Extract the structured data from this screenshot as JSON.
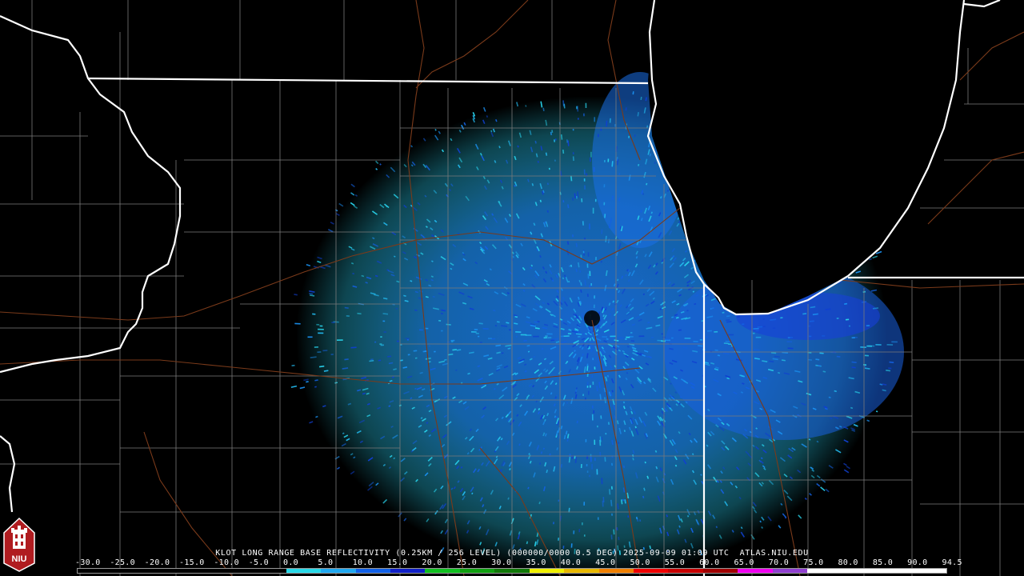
{
  "caption": "KLOT LONG RANGE BASE REFLECTIVITY (0.25KM / 256 LEVEL) (000000/0000 0.5 DEG) 2025-09-09 01:09 UTC  ATLAS.NIU.EDU",
  "logo": {
    "text": "NIU",
    "icon": "university-tower-icon"
  },
  "radar": {
    "site": "KLOT",
    "product": "LONG RANGE BASE REFLECTIVITY",
    "timestamp": "2025-09-09 01:09 UTC"
  },
  "scale": {
    "labels": [
      "-30.0",
      "-25.0",
      "-20.0",
      "-15.0",
      "-10.0",
      "-5.0",
      "0.0",
      "5.0",
      "10.0",
      "15.0",
      "20.0",
      "25.0",
      "30.0",
      "35.0",
      "40.0",
      "45.0",
      "50.0",
      "55.0",
      "60.0",
      "65.0",
      "70.0",
      "75.0",
      "80.0",
      "85.0",
      "90.0",
      "94.5"
    ],
    "colors": [
      "#000000",
      "#000000",
      "#000000",
      "#000000",
      "#000000",
      "#000000",
      "#28d8e8",
      "#20a8f0",
      "#1060e8",
      "#1020c8",
      "#10c020",
      "#10a010",
      "#107808",
      "#f0f000",
      "#e8b800",
      "#f08000",
      "#f00000",
      "#c80000",
      "#a00000",
      "#f000f0",
      "#9040d0",
      "#ffffff",
      "#ffffff",
      "#ffffff",
      "#ffffff"
    ]
  },
  "colors": {
    "background": "#000000",
    "state_border": "#ffffff",
    "county_line": "#7a7a7a",
    "highway": "#7a3a1a",
    "echo_light": "#28d0e8",
    "echo_mid": "#1c9af0",
    "echo_dense": "#1050e0"
  }
}
